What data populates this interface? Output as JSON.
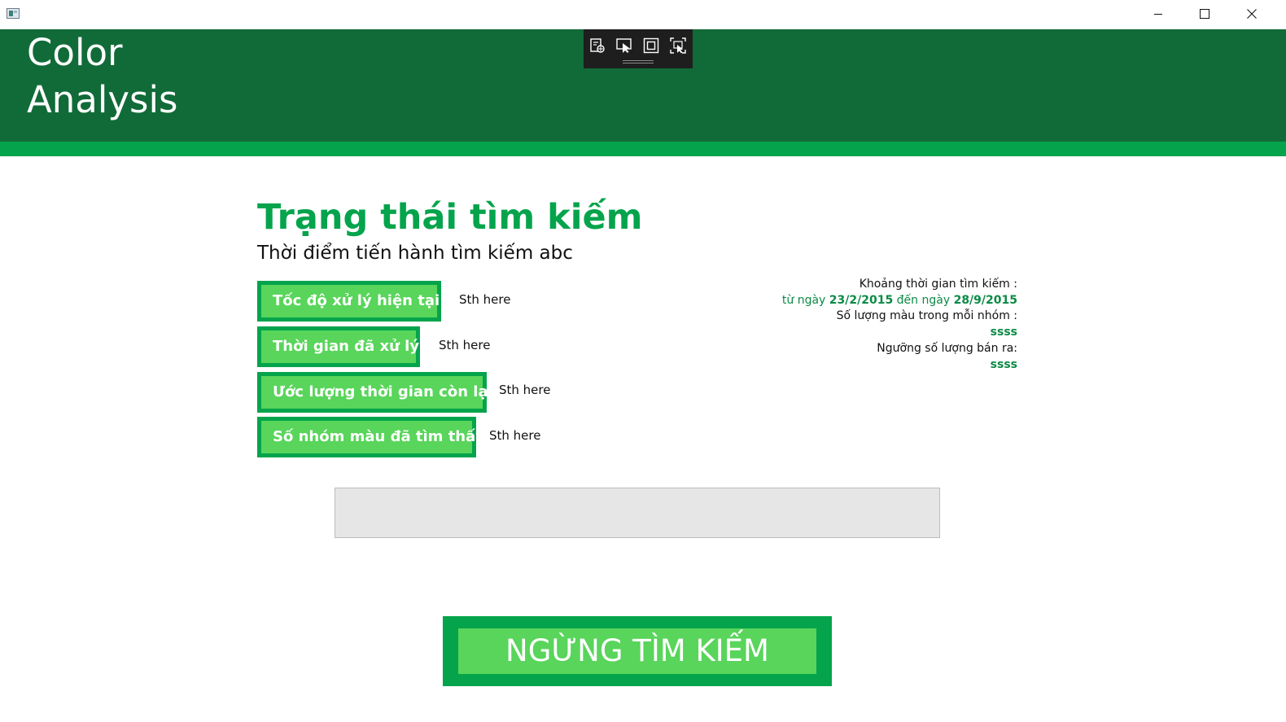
{
  "window": {
    "minimize_icon": "minimize-icon",
    "maximize_icon": "maximize-icon",
    "close_icon": "close-icon"
  },
  "header": {
    "title": "Color Analysis",
    "toolbar_icons": [
      "select-element-icon",
      "cursor-select-icon",
      "layout-adorner-icon",
      "track-focus-icon"
    ]
  },
  "main": {
    "heading": "Trạng thái tìm kiếm",
    "subtitle": "Thời điểm tiến hành tìm kiếm abc",
    "stats": [
      {
        "label": "Tốc độ xử lý hiện tại :",
        "value": "Sth here"
      },
      {
        "label": "Thời gian đã xử lý:",
        "value": "Sth here"
      },
      {
        "label": "Ước lượng thời gian còn lại:",
        "value": "Sth here"
      },
      {
        "label": "Số nhóm màu đã tìm thấy:",
        "value": "Sth here"
      }
    ]
  },
  "info": {
    "range_label": "Khoảng thời gian tìm kiếm :",
    "from_text": "từ ngày",
    "from_date": "23/2/2015",
    "to_text": "đến ngày",
    "to_date": "28/9/2015",
    "colors_label": "Số lượng màu trong mỗi nhóm :",
    "colors_value": "ssss",
    "threshold_label": "Ngưỡng số lượng bán ra:",
    "threshold_value": "ssss"
  },
  "actions": {
    "stop_label": "NGỪNG TÌM KIẾM"
  },
  "colors": {
    "header_dark": "#116b38",
    "accent_green": "#05a44c",
    "button_fill": "#58d55a",
    "text_green": "#0b8a45"
  }
}
